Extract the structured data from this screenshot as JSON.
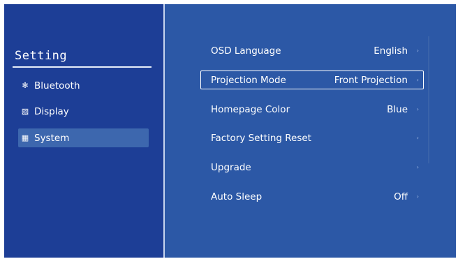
{
  "sidebar": {
    "title": "Setting",
    "items": [
      {
        "icon": "bluetooth-icon",
        "glyph": "✻",
        "label": "Bluetooth"
      },
      {
        "icon": "display-icon",
        "glyph": "▨",
        "label": "Display"
      },
      {
        "icon": "system-icon",
        "glyph": "▦",
        "label": "System"
      }
    ]
  },
  "menu": {
    "items": [
      {
        "label": "OSD Language",
        "value": "English",
        "chevron": "›"
      },
      {
        "label": "Projection Mode",
        "value": "Front Projection",
        "chevron": "›"
      },
      {
        "label": "Homepage Color",
        "value": "Blue",
        "chevron": "›"
      },
      {
        "label": "Factory Setting Reset",
        "value": "",
        "chevron": "›"
      },
      {
        "label": "Upgrade",
        "value": "",
        "chevron": "›"
      },
      {
        "label": "Auto Sleep",
        "value": "Off",
        "chevron": "›"
      }
    ]
  },
  "colors": {
    "background": "#2c58a6",
    "sidebar": "#1d3e96",
    "selected": "#3d67ae",
    "text": "#ffffff"
  }
}
